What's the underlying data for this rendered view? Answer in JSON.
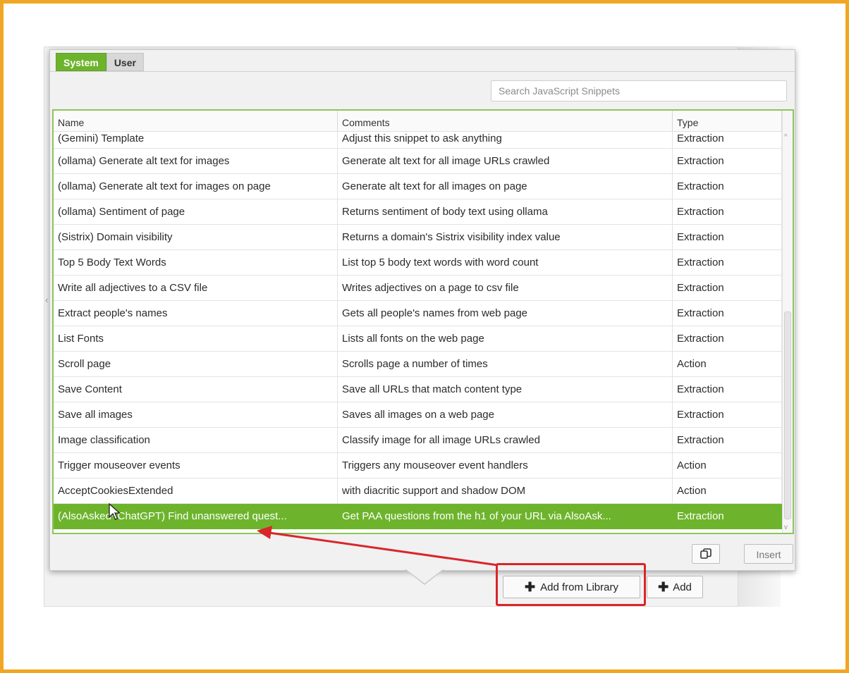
{
  "tabs": [
    {
      "label": "System",
      "active": true
    },
    {
      "label": "User",
      "active": false
    }
  ],
  "search": {
    "placeholder": "Search JavaScript Snippets"
  },
  "table": {
    "headers": [
      "Name",
      "Comments",
      "Type"
    ],
    "rows": [
      {
        "name": "(Gemini) Template",
        "comment": "Adjust this snippet to ask anything",
        "type": "Extraction"
      },
      {
        "name": "(ollama) Generate alt text for images",
        "comment": "Generate alt text for all image URLs crawled",
        "type": "Extraction"
      },
      {
        "name": "(ollama) Generate alt text for images on page",
        "comment": "Generate alt text for all images on page",
        "type": "Extraction"
      },
      {
        "name": "(ollama) Sentiment of page",
        "comment": "Returns sentiment of body text using ollama",
        "type": "Extraction"
      },
      {
        "name": "(Sistrix) Domain visibility",
        "comment": "Returns a domain's Sistrix visibility index value",
        "type": "Extraction"
      },
      {
        "name": "Top 5 Body Text Words",
        "comment": "List top 5 body text words with word count",
        "type": "Extraction"
      },
      {
        "name": "Write all adjectives to a CSV file",
        "comment": "Writes adjectives on a page to csv file",
        "type": "Extraction"
      },
      {
        "name": "Extract people's names",
        "comment": "Gets all people's names from web page",
        "type": "Extraction"
      },
      {
        "name": "List Fonts",
        "comment": "Lists all fonts on the web page",
        "type": "Extraction"
      },
      {
        "name": "Scroll page",
        "comment": "Scrolls page a number of times",
        "type": "Action"
      },
      {
        "name": "Save Content",
        "comment": "Save all URLs that match content type",
        "type": "Extraction"
      },
      {
        "name": "Save all images",
        "comment": "Saves all images on a web page",
        "type": "Extraction"
      },
      {
        "name": "Image classification",
        "comment": "Classify image for all image URLs crawled",
        "type": "Extraction"
      },
      {
        "name": "Trigger mouseover events",
        "comment": "Triggers any mouseover event handlers",
        "type": "Action"
      },
      {
        "name": "AcceptCookiesExtended",
        "comment": "with diacritic support and shadow DOM",
        "type": "Action"
      },
      {
        "name": "(AlsoAsked+ChatGPT) Find unanswered quest...",
        "comment": "Get PAA questions from the h1 of your URL via AlsoAsk...",
        "type": "Extraction",
        "selected": true
      }
    ]
  },
  "buttons": {
    "insert": "Insert",
    "add_from_library": "Add from Library",
    "add": "Add"
  },
  "icons": {
    "copy": "copy-icon",
    "plus": "plus-icon",
    "cursor": "mouse-pointer-icon"
  },
  "colors": {
    "accent_green": "#6db42c",
    "frame_orange": "#f0a623",
    "annotation_red": "#d8262a"
  }
}
